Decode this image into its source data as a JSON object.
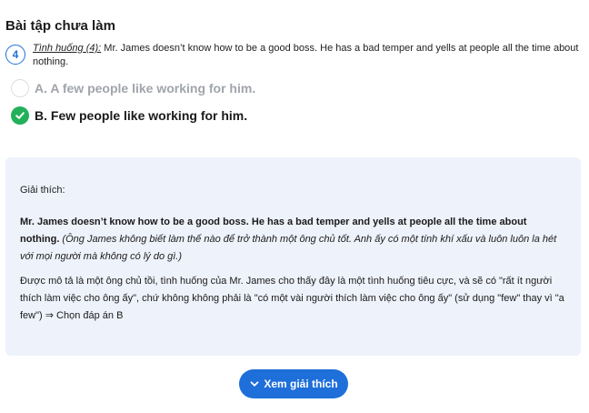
{
  "section": {
    "title": "Bài tập chưa làm"
  },
  "question": {
    "number": "4",
    "tag": "Tình huống (4):",
    "text": " Mr. James doesn’t know how to be a good boss. He has a bad temper and yells at people all the time about nothing."
  },
  "options": [
    {
      "label": "A. A few people like working for him.",
      "state": "unselected"
    },
    {
      "label": "B. Few people like working for him.",
      "state": "correct"
    }
  ],
  "explanation": {
    "heading": "Giải thích:",
    "p1_english": "Mr. James doesn’t know how to be a good boss. He has a bad temper and yells at people all the time about nothing.",
    "p1_vietnamese": " (Ông James không biết làm thế nào để trở thành một ông chủ tốt. Anh ấy có một tính khí xấu và luôn luôn la hét với mọi người mà không có lý do gì.)",
    "p2": "Được mô tả là một ông chủ tồi, tình huống của Mr. James cho thấy đây là một tình huống tiêu cực, và sẽ có \"rất ít người thích làm việc cho ông ấy\", chứ không không phải là \"có một vài người thích làm việc cho ông ấy\" (sử dụng \"few\" thay vì \"a few\") ⇒ Chọn đáp án B"
  },
  "button": {
    "label": "Xem giải thích",
    "icon": "chevron-down-icon"
  },
  "colors": {
    "accent": "#1e6fd9",
    "correct": "#22b05a",
    "panel": "#eef2fb"
  }
}
